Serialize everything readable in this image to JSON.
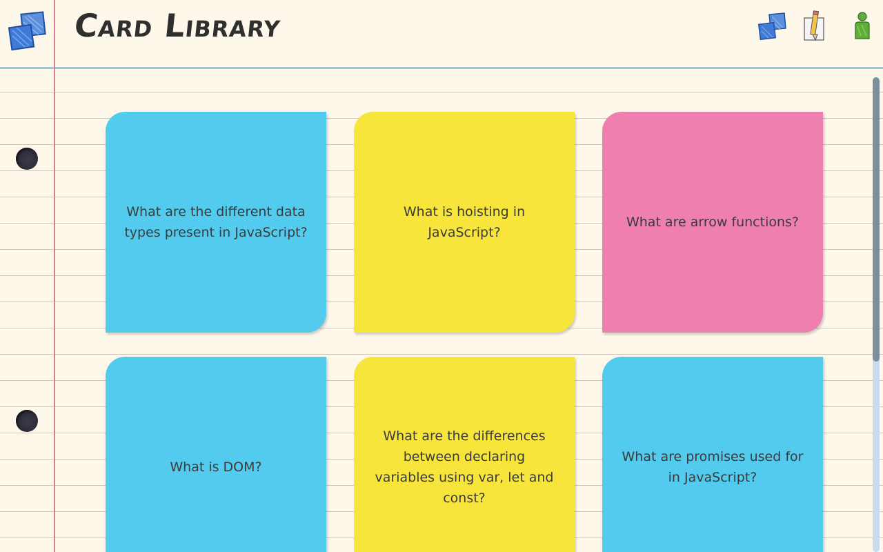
{
  "header": {
    "title": "Card Library",
    "icons": [
      "cards-icon",
      "edit-pencil-icon",
      "user-icon"
    ]
  },
  "colors": {
    "blue": "#52cbef",
    "yellow": "#f7e53b",
    "pink": "#ef7faf",
    "paper": "#fef8ea",
    "rule_line": "#9fd3e8",
    "margin_line": "#e07b8f"
  },
  "cards": [
    {
      "text": "What are the different data types present in JavaScript?",
      "color": "blue"
    },
    {
      "text": "What is hoisting in JavaScript?",
      "color": "yellow"
    },
    {
      "text": "What are arrow functions?",
      "color": "pink"
    },
    {
      "text": "What is DOM?",
      "color": "blue"
    },
    {
      "text": "What are the differences between declaring variables using var, let and const?",
      "color": "yellow"
    },
    {
      "text": "What are promises used for in JavaScript?",
      "color": "blue"
    }
  ]
}
